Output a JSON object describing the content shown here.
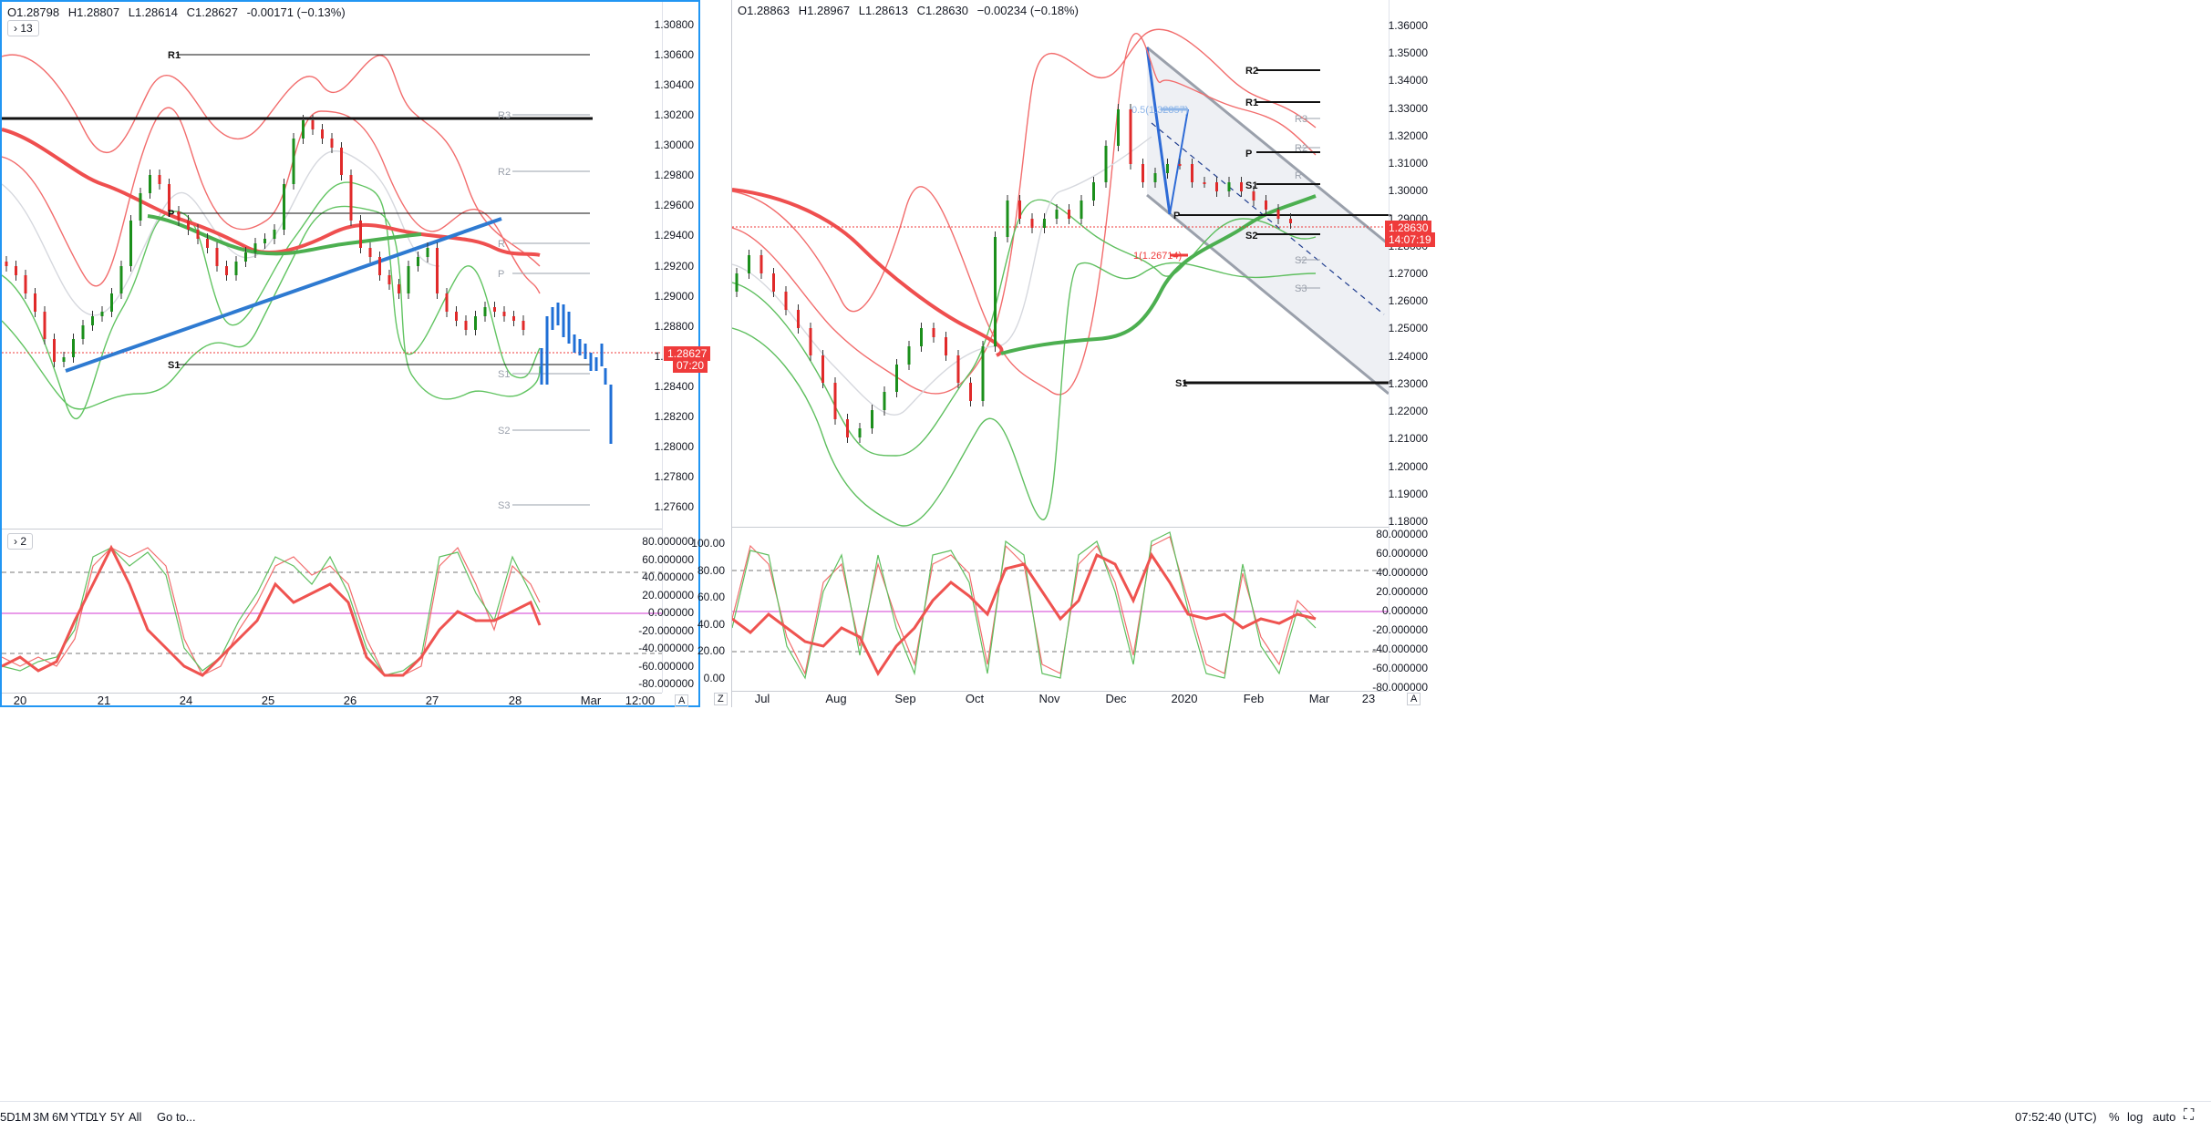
{
  "left_chart": {
    "ohlc": {
      "o": "O1.28798",
      "h": "H1.28807",
      "l": "L1.28614",
      "c": "C1.28627",
      "chg": "-0.00171 (−0.13%)"
    },
    "indicator_chip": "13",
    "price_labels": [
      "1.30800",
      "1.30600",
      "1.30400",
      "1.30200",
      "1.30000",
      "1.29800",
      "1.29600",
      "1.29400",
      "1.29200",
      "1.29000",
      "1.28800",
      "1.28600",
      "1.28400",
      "1.28200",
      "1.28000",
      "1.27800",
      "1.27600"
    ],
    "last_price": "1.28627",
    "countdown": "07:20",
    "pivot_labels": {
      "r1": "R1",
      "p": "P",
      "s1": "S1",
      "r3": "R3",
      "r2": "R2",
      "r": "R",
      "p2": "P",
      "s1b": "S1",
      "s2": "S2",
      "s3": "S3"
    },
    "osc_chip": "2",
    "osc_labels": [
      "80.000000",
      "60.000000",
      "40.000000",
      "20.000000",
      "0.000000",
      "-20.000000",
      "-40.000000",
      "-60.000000",
      "-80.000000"
    ],
    "x_labels": [
      "20",
      "21",
      "24",
      "25",
      "26",
      "27",
      "28",
      "Mar",
      "12:00"
    ],
    "x_corner": "A"
  },
  "right_chart": {
    "ohlc": {
      "o": "O1.28863",
      "h": "H1.28967",
      "l": "L1.28613",
      "c": "C1.28630",
      "chg": "−0.00234 (−0.18%)"
    },
    "price_labels": [
      "1.36000",
      "1.35000",
      "1.34000",
      "1.33000",
      "1.32000",
      "1.31000",
      "1.30000",
      "1.29000",
      "1.28000",
      "1.27000",
      "1.26000",
      "1.25000",
      "1.24000",
      "1.23000",
      "1.22000",
      "1.21000",
      "1.20000",
      "1.19000",
      "1.18000"
    ],
    "last_price": "1.28630",
    "countdown": "14:07:19",
    "pivot_labels": {
      "r2": "R2",
      "r1": "R1",
      "r3": "R3",
      "r2b": "R2",
      "p": "P",
      "r": "R",
      "s1": "S1",
      "p2": "P",
      "s2": "S2",
      "s2b": "S2",
      "s3": "S3",
      "s1big": "S1"
    },
    "fib_label": "0.5(1.32857)",
    "fib_label2": "1(1.26714)",
    "osc_left_labels": [
      "100.00",
      "80.00",
      "60.00",
      "40.00",
      "20.00",
      "0.00"
    ],
    "osc_labels": [
      "80.000000",
      "60.000000",
      "40.000000",
      "20.000000",
      "0.000000",
      "-20.000000",
      "-40.000000",
      "-60.000000",
      "-80.000000"
    ],
    "x_labels": [
      "Jul",
      "Aug",
      "Sep",
      "Oct",
      "Nov",
      "Dec",
      "2020",
      "Feb",
      "Mar",
      "23"
    ],
    "x_corner": "A",
    "z_chip": "Z"
  },
  "bottom_bar": {
    "ranges": [
      "5D",
      "1M",
      "3M",
      "6M",
      "YTD",
      "1Y",
      "5Y",
      "All"
    ],
    "goto": "Go to...",
    "time": "07:52:40 (UTC)",
    "pct": "%",
    "log": "log",
    "auto": "auto"
  },
  "colors": {
    "up": "#26a69a",
    "down": "#ef5350",
    "bb_red": "#f26d6d",
    "bb_green": "#5fbf5f",
    "blue": "#2e7ad1",
    "trend_blue": "#1f6fd6"
  }
}
